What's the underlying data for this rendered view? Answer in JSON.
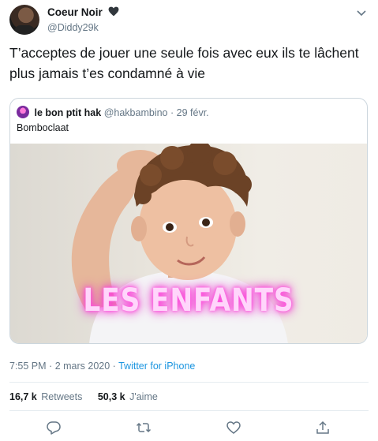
{
  "author": {
    "display_name": "Coeur Noir",
    "handle": "@Diddy29k"
  },
  "tweet": {
    "text": "T’acceptes de jouer une seule fois avec eux ils te lâchent plus jamais t’es condamné à vie",
    "time": "7:55 PM",
    "date": "2 mars 2020",
    "separator": "·",
    "source": "Twitter for iPhone"
  },
  "quoted_tweet": {
    "display_name": "le bon ptit hak",
    "handle": "@hakbambino",
    "separator": "·",
    "date": "29 févr.",
    "text": "Bomboclaat",
    "media_caption": "LES ENFANTS"
  },
  "stats": {
    "retweets_count": "16,7 k",
    "retweets_label": "Retweets",
    "likes_count": "50,3 k",
    "likes_label": "J'aime"
  },
  "icons": {
    "heart_emoji": "heart-icon",
    "caret": "chevron-down-icon",
    "reply": "reply-icon",
    "retweet": "retweet-icon",
    "like": "like-icon",
    "share": "share-icon"
  },
  "colors": {
    "text": "#14171a",
    "secondary": "#657786",
    "link": "#1b95e0",
    "border": "#ccd6dd",
    "caption_glow": "#ff3ed6"
  }
}
